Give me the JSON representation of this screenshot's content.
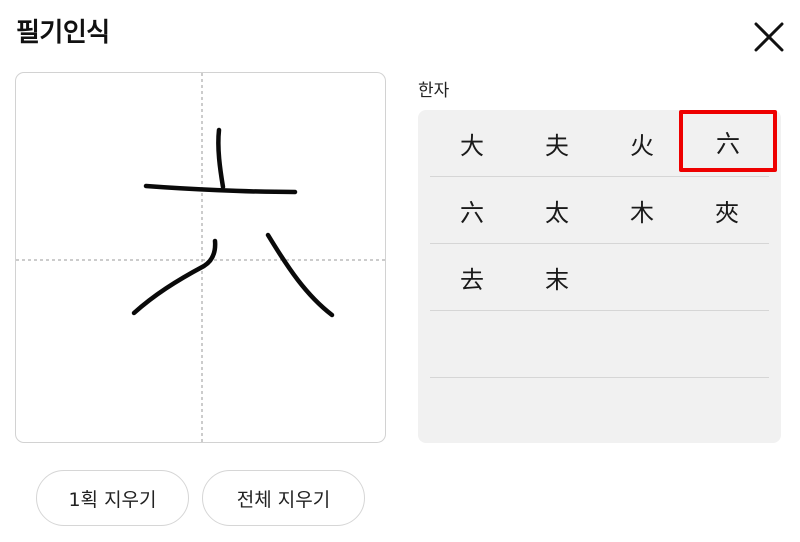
{
  "header": {
    "title": "필기인식",
    "close_icon": "close-icon"
  },
  "results": {
    "label": "한자",
    "rows": [
      [
        "大",
        "夫",
        "火",
        "六"
      ],
      [
        "六",
        "太",
        "木",
        "夾"
      ],
      [
        "去",
        "末",
        "",
        ""
      ],
      [
        "",
        "",
        "",
        ""
      ],
      [
        "",
        "",
        "",
        ""
      ]
    ],
    "highlight_color": "#ee0000"
  },
  "buttons": {
    "erase_stroke": "1획 지우기",
    "erase_all": "전체 지우기"
  }
}
